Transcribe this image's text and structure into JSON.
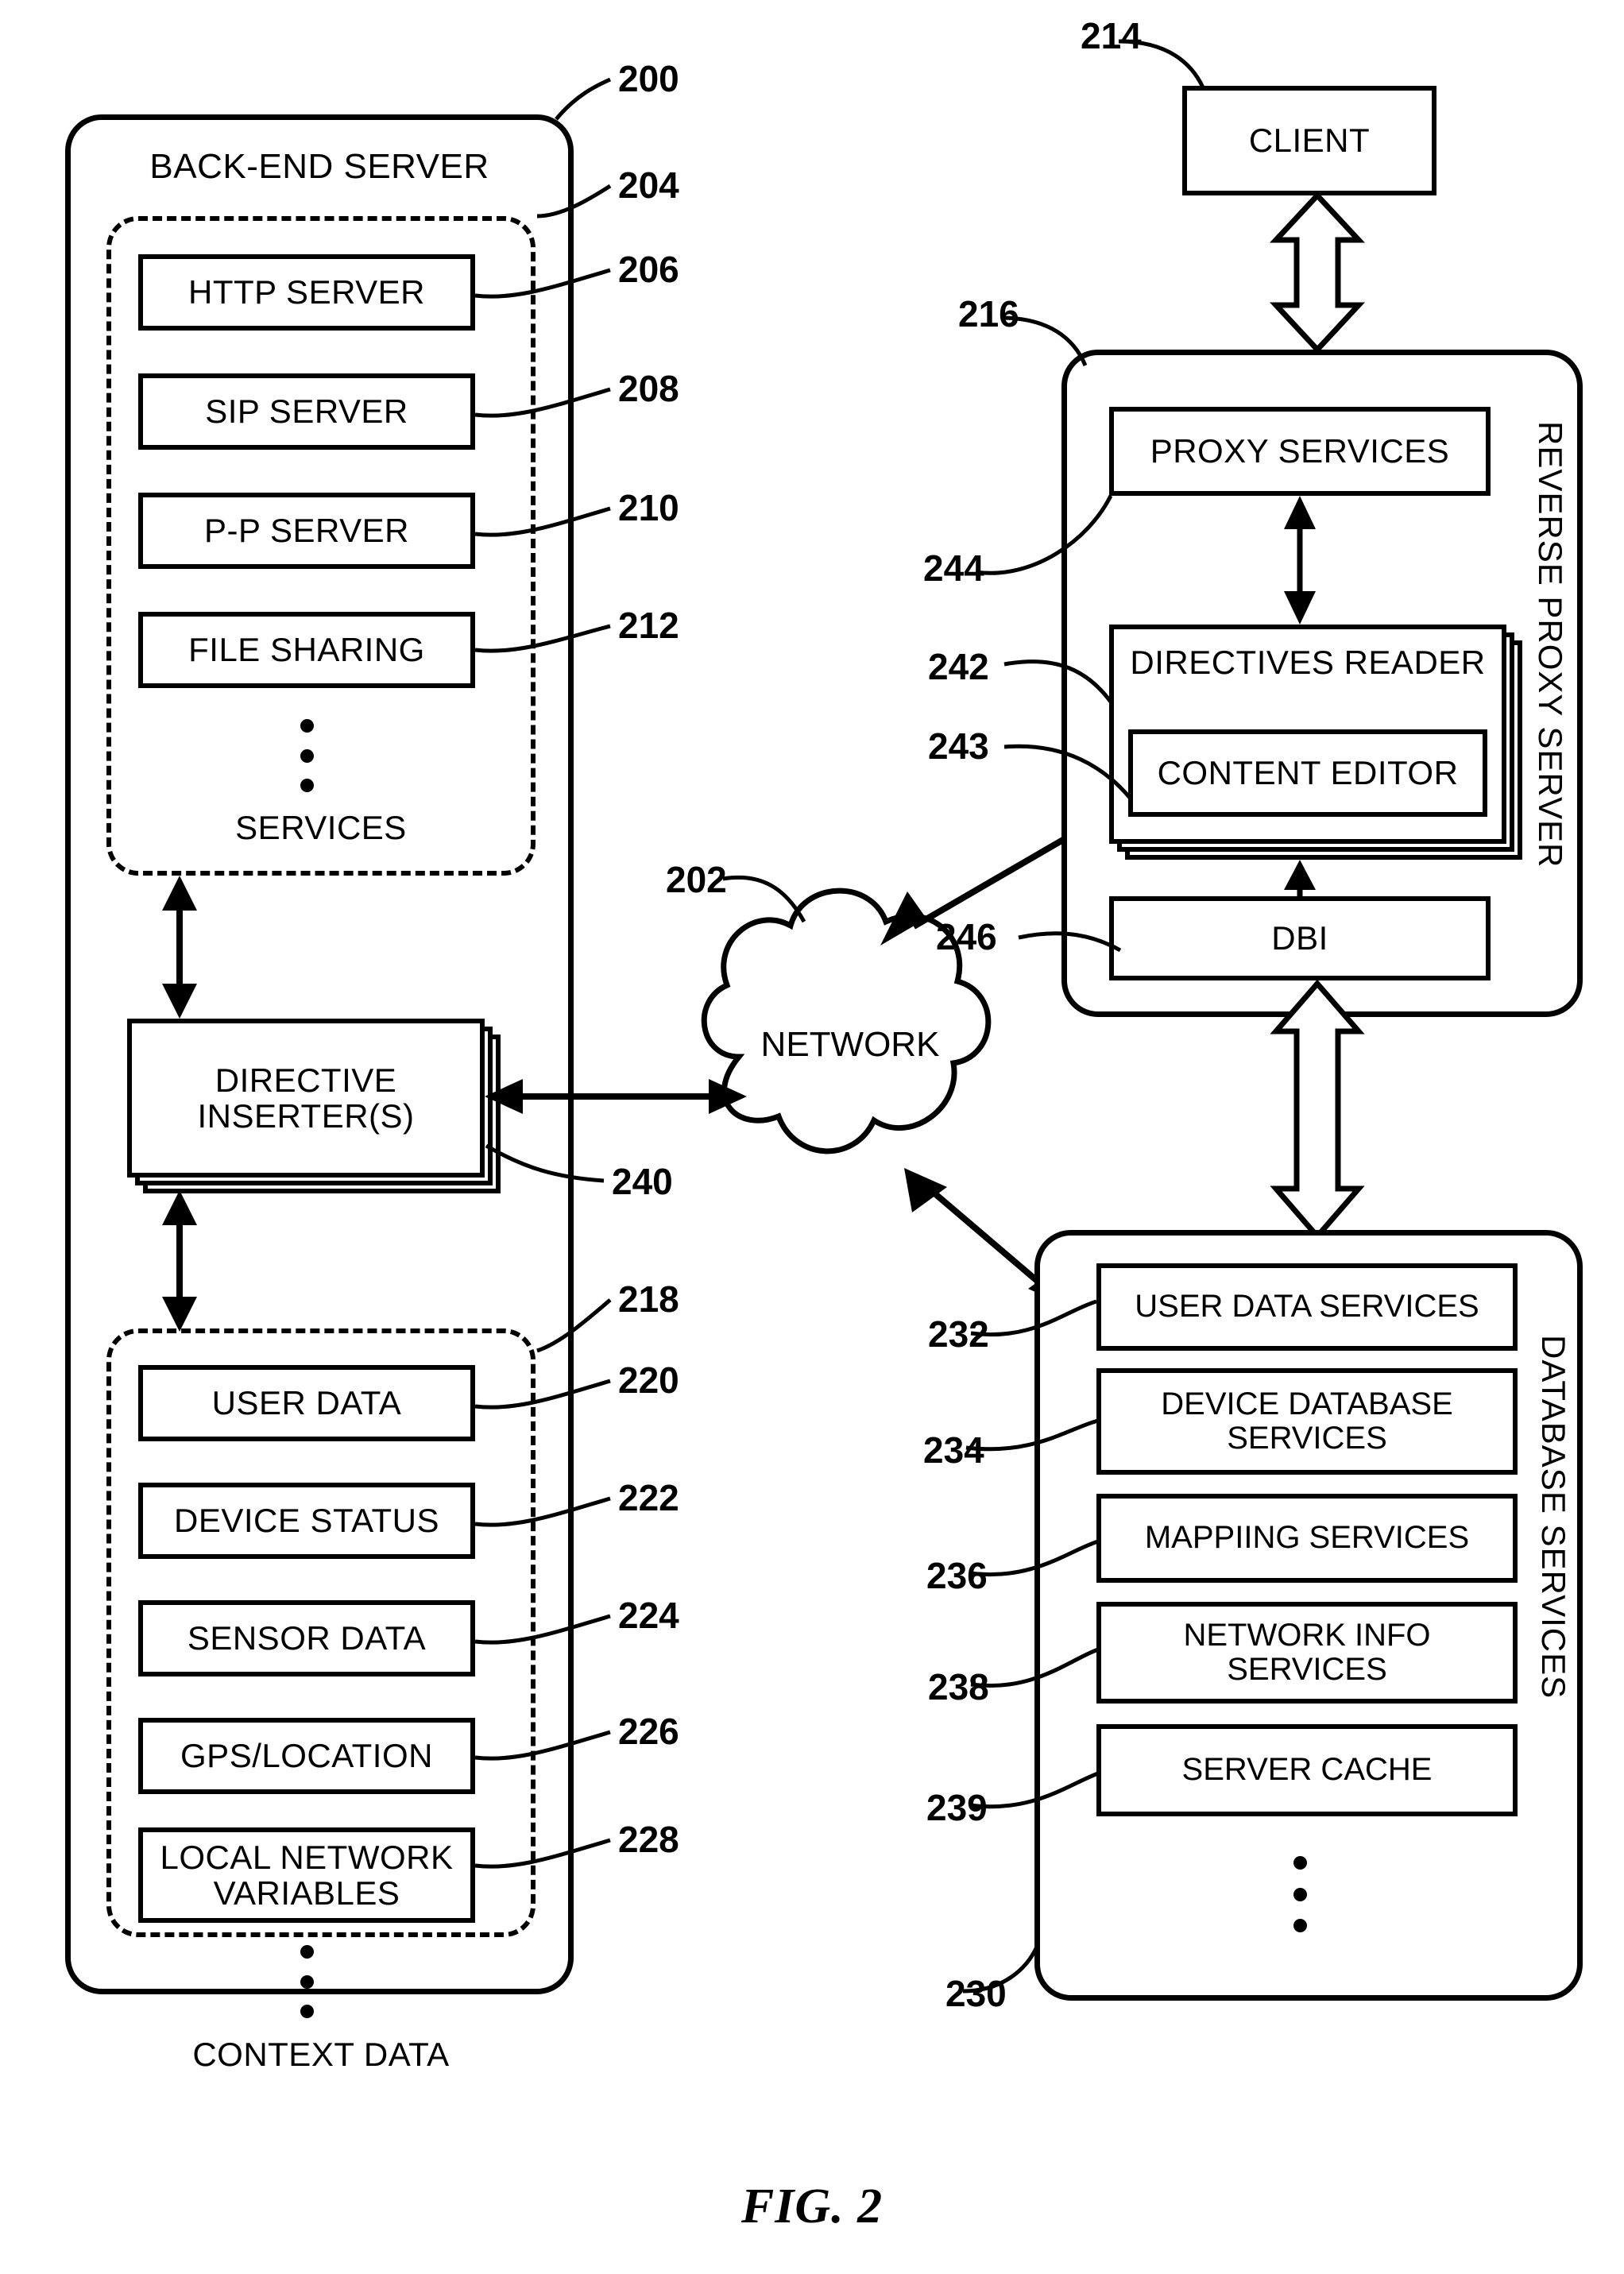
{
  "figure": {
    "caption": "FIG. 2"
  },
  "back_end_server": {
    "title": "BACK-END SERVER",
    "ref": "200",
    "services_group": {
      "ref": "204",
      "caption": "SERVICES",
      "items": [
        {
          "label": "HTTP SERVER",
          "ref": "206"
        },
        {
          "label": "SIP SERVER",
          "ref": "208"
        },
        {
          "label": "P-P SERVER",
          "ref": "210"
        },
        {
          "label": "FILE SHARING",
          "ref": "212"
        }
      ]
    },
    "directive_inserter": {
      "label": "DIRECTIVE\nINSERTER(S)",
      "ref": "240"
    },
    "context_group": {
      "ref": "218",
      "caption": "CONTEXT DATA",
      "items": [
        {
          "label": "USER DATA",
          "ref": "220"
        },
        {
          "label": "DEVICE STATUS",
          "ref": "222"
        },
        {
          "label": "SENSOR DATA",
          "ref": "224"
        },
        {
          "label": "GPS/LOCATION",
          "ref": "226"
        },
        {
          "label": "LOCAL NETWORK\nVARIABLES",
          "ref": "228"
        }
      ]
    }
  },
  "network": {
    "label": "NETWORK",
    "ref": "202"
  },
  "client": {
    "label": "CLIENT",
    "ref": "214"
  },
  "reverse_proxy_server": {
    "side_title": "REVERSE PROXY SERVER",
    "ref": "216",
    "proxy_services": {
      "label": "PROXY SERVICES",
      "ref": "244"
    },
    "directives_reader": {
      "label": "DIRECTIVES READER",
      "ref": "242"
    },
    "content_editor": {
      "label": "CONTENT EDITOR",
      "ref": "243"
    },
    "dbi": {
      "label": "DBI",
      "ref": "246"
    }
  },
  "database_services": {
    "side_title": "DATABASE SERVICES",
    "ref": "230",
    "items": [
      {
        "label": "USER DATA SERVICES",
        "ref": "232"
      },
      {
        "label": "DEVICE DATABASE\nSERVICES",
        "ref": "234"
      },
      {
        "label": "MAPPIING SERVICES",
        "ref": "236"
      },
      {
        "label": "NETWORK INFO\nSERVICES",
        "ref": "238"
      },
      {
        "label": "SERVER CACHE",
        "ref": "239"
      }
    ]
  }
}
